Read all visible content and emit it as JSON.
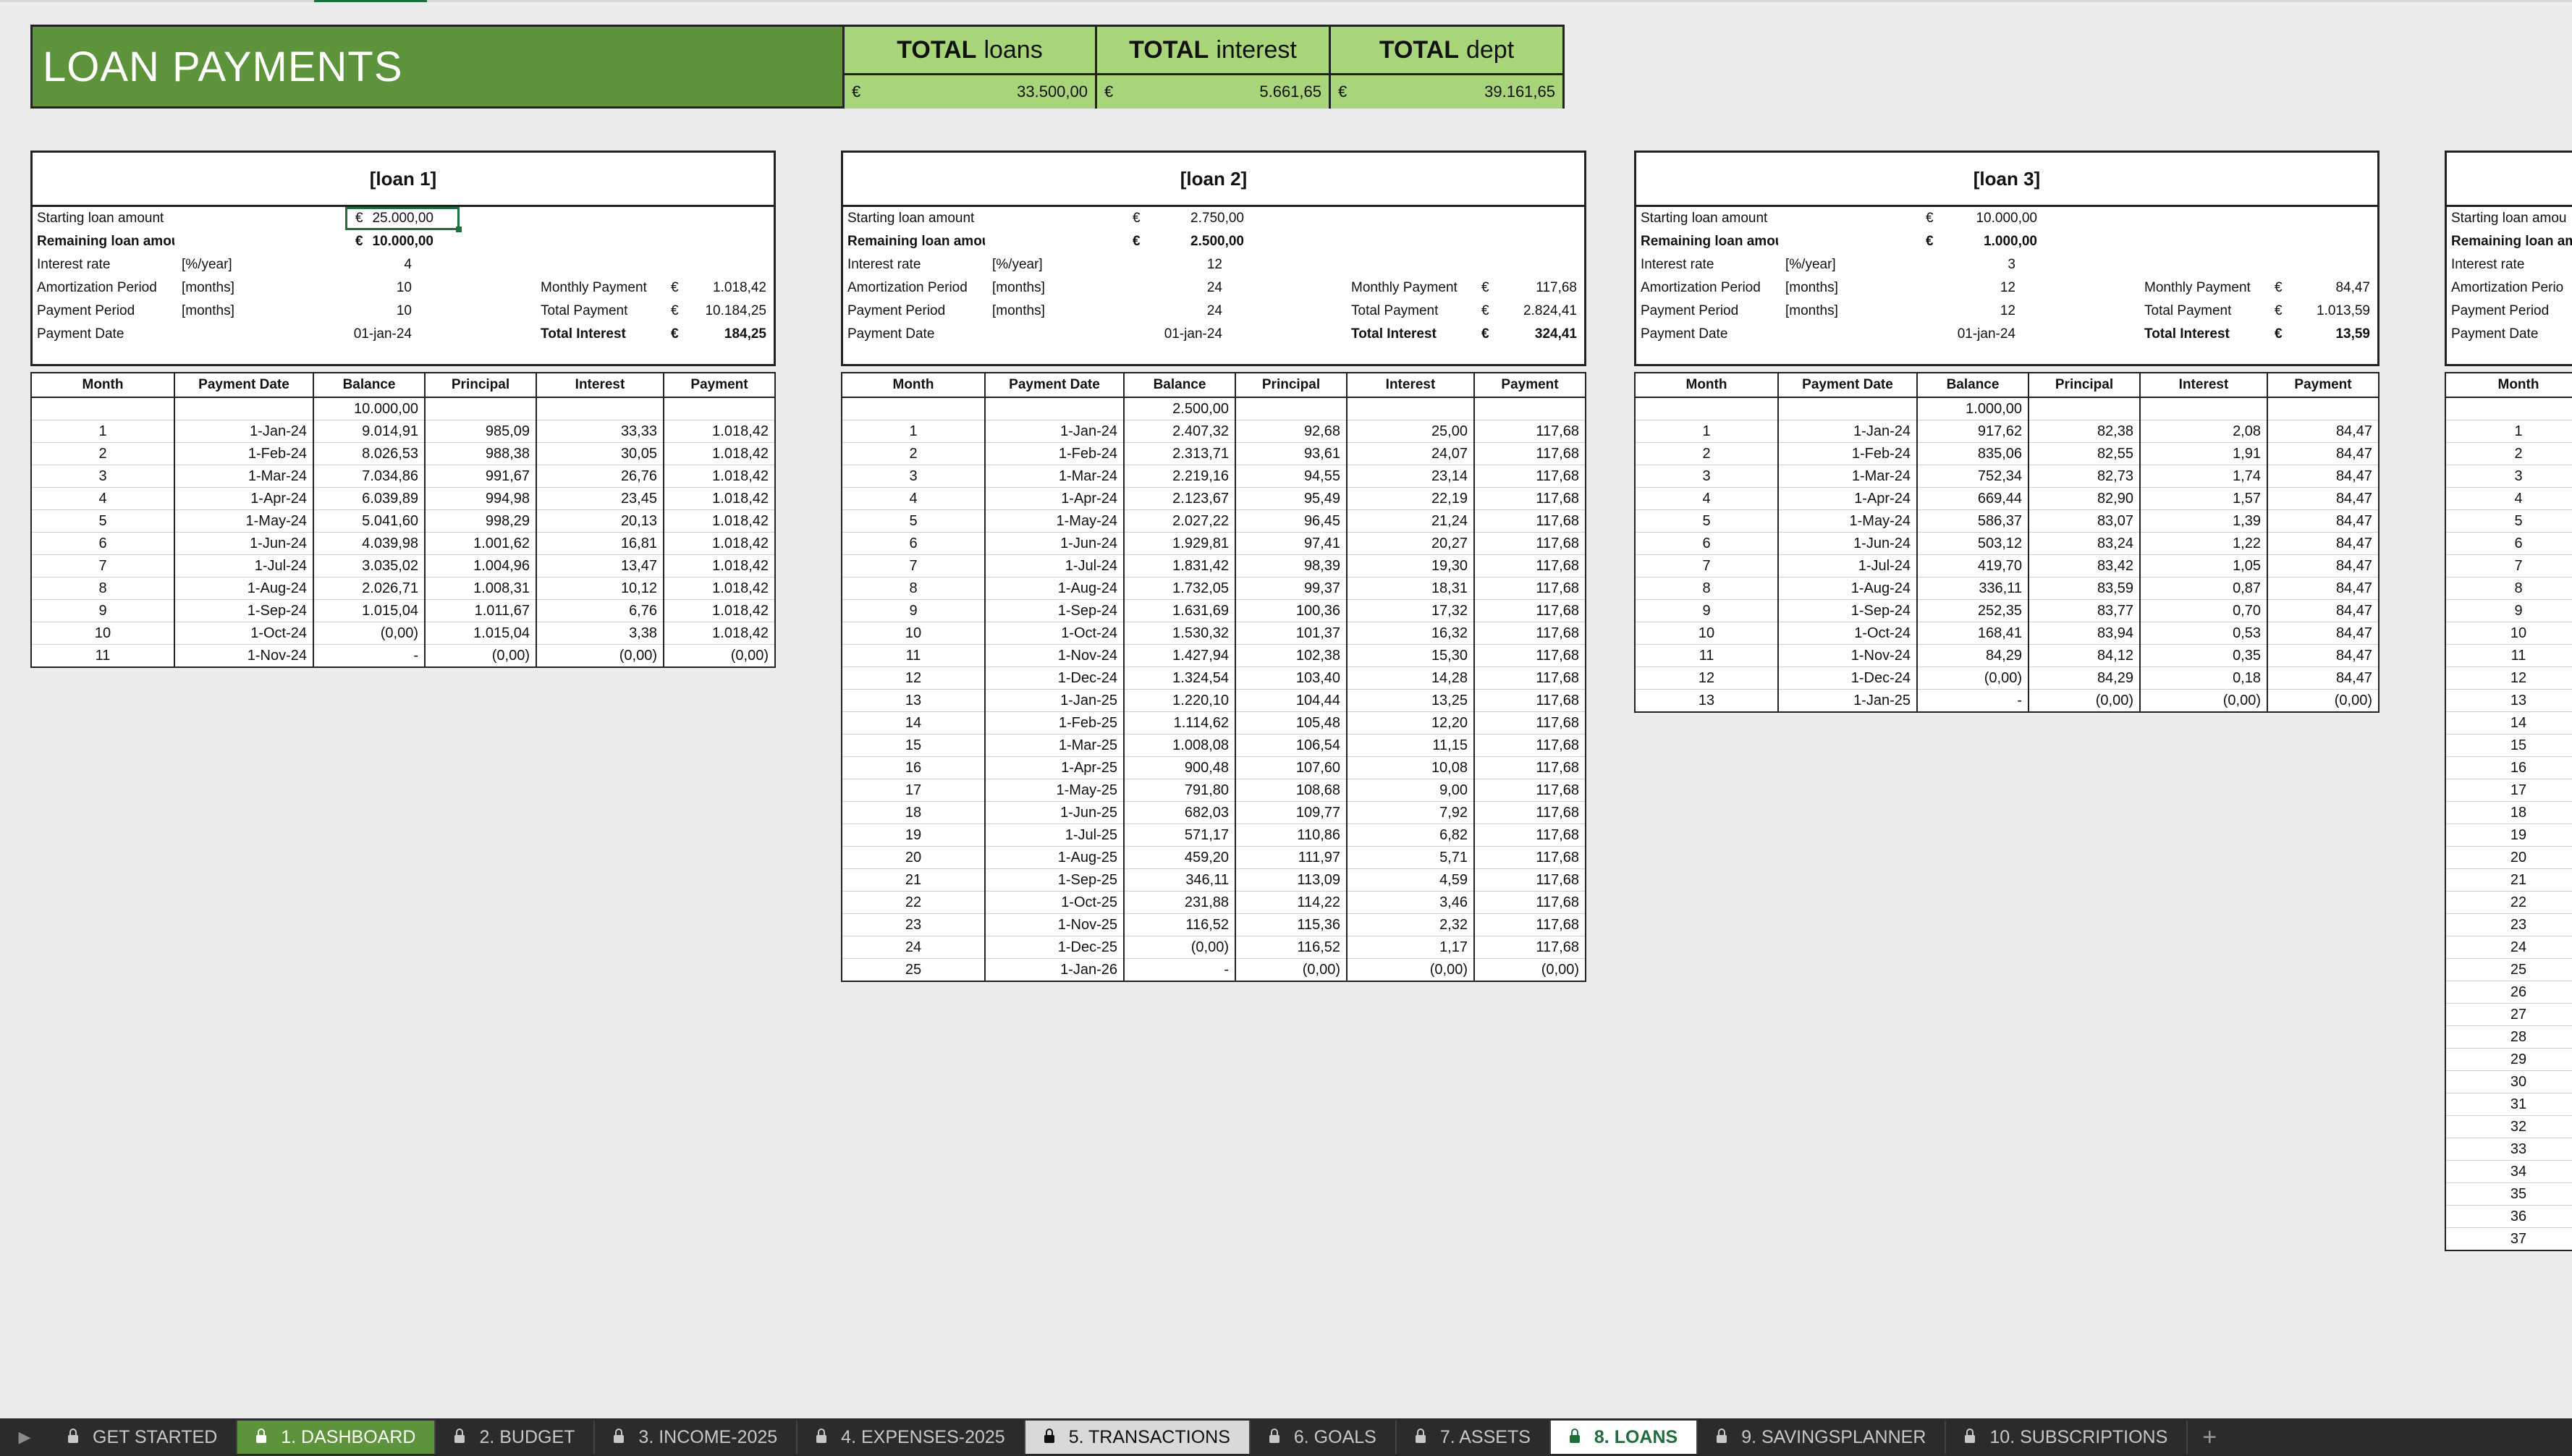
{
  "header": {
    "title": "LOAN PAYMENTS",
    "totals": [
      {
        "bold": "TOTAL",
        "rest": "loans",
        "currency": "€",
        "value": "33.500,00"
      },
      {
        "bold": "TOTAL",
        "rest": "interest",
        "currency": "€",
        "value": "5.661,65"
      },
      {
        "bold": "TOTAL",
        "rest": "dept",
        "currency": "€",
        "value": "39.161,65"
      }
    ]
  },
  "labels": {
    "starting": "Starting loan amount",
    "remaining": "Remaining loan amount",
    "interest_rate": "Interest rate",
    "amortization": "Amortization Period",
    "payment_period": "Payment Period",
    "payment_date": "Payment Date",
    "unit_rate": "[%/year]",
    "unit_months": "[months]",
    "monthly_payment": "Monthly Payment",
    "total_payment": "Total Payment",
    "total_interest": "Total Interest",
    "currency": "€"
  },
  "columns": [
    "Month",
    "Payment Date",
    "Balance",
    "Principal",
    "Interest",
    "Payment"
  ],
  "loans": [
    {
      "title": "[loan 1]",
      "starting": "25.000,00",
      "remaining": "10.000,00",
      "rate": "4",
      "amortization": "10",
      "period": "10",
      "date": "01-jan-24",
      "monthly_payment": "1.018,42",
      "total_payment": "10.184,25",
      "total_interest": "184,25",
      "initial_balance": "10.000,00",
      "rows": [
        [
          "1",
          "1-Jan-24",
          "9.014,91",
          "985,09",
          "33,33",
          "1.018,42"
        ],
        [
          "2",
          "1-Feb-24",
          "8.026,53",
          "988,38",
          "30,05",
          "1.018,42"
        ],
        [
          "3",
          "1-Mar-24",
          "7.034,86",
          "991,67",
          "26,76",
          "1.018,42"
        ],
        [
          "4",
          "1-Apr-24",
          "6.039,89",
          "994,98",
          "23,45",
          "1.018,42"
        ],
        [
          "5",
          "1-May-24",
          "5.041,60",
          "998,29",
          "20,13",
          "1.018,42"
        ],
        [
          "6",
          "1-Jun-24",
          "4.039,98",
          "1.001,62",
          "16,81",
          "1.018,42"
        ],
        [
          "7",
          "1-Jul-24",
          "3.035,02",
          "1.004,96",
          "13,47",
          "1.018,42"
        ],
        [
          "8",
          "1-Aug-24",
          "2.026,71",
          "1.008,31",
          "10,12",
          "1.018,42"
        ],
        [
          "9",
          "1-Sep-24",
          "1.015,04",
          "1.011,67",
          "6,76",
          "1.018,42"
        ],
        [
          "10",
          "1-Oct-24",
          "(0,00)",
          "1.015,04",
          "3,38",
          "1.018,42"
        ],
        [
          "11",
          "1-Nov-24",
          "-",
          "(0,00)",
          "(0,00)",
          "(0,00)"
        ]
      ]
    },
    {
      "title": "[loan 2]",
      "starting": "2.750,00",
      "remaining": "2.500,00",
      "rate": "12",
      "amortization": "24",
      "period": "24",
      "date": "01-jan-24",
      "monthly_payment": "117,68",
      "total_payment": "2.824,41",
      "total_interest": "324,41",
      "initial_balance": "2.500,00",
      "rows": [
        [
          "1",
          "1-Jan-24",
          "2.407,32",
          "92,68",
          "25,00",
          "117,68"
        ],
        [
          "2",
          "1-Feb-24",
          "2.313,71",
          "93,61",
          "24,07",
          "117,68"
        ],
        [
          "3",
          "1-Mar-24",
          "2.219,16",
          "94,55",
          "23,14",
          "117,68"
        ],
        [
          "4",
          "1-Apr-24",
          "2.123,67",
          "95,49",
          "22,19",
          "117,68"
        ],
        [
          "5",
          "1-May-24",
          "2.027,22",
          "96,45",
          "21,24",
          "117,68"
        ],
        [
          "6",
          "1-Jun-24",
          "1.929,81",
          "97,41",
          "20,27",
          "117,68"
        ],
        [
          "7",
          "1-Jul-24",
          "1.831,42",
          "98,39",
          "19,30",
          "117,68"
        ],
        [
          "8",
          "1-Aug-24",
          "1.732,05",
          "99,37",
          "18,31",
          "117,68"
        ],
        [
          "9",
          "1-Sep-24",
          "1.631,69",
          "100,36",
          "17,32",
          "117,68"
        ],
        [
          "10",
          "1-Oct-24",
          "1.530,32",
          "101,37",
          "16,32",
          "117,68"
        ],
        [
          "11",
          "1-Nov-24",
          "1.427,94",
          "102,38",
          "15,30",
          "117,68"
        ],
        [
          "12",
          "1-Dec-24",
          "1.324,54",
          "103,40",
          "14,28",
          "117,68"
        ],
        [
          "13",
          "1-Jan-25",
          "1.220,10",
          "104,44",
          "13,25",
          "117,68"
        ],
        [
          "14",
          "1-Feb-25",
          "1.114,62",
          "105,48",
          "12,20",
          "117,68"
        ],
        [
          "15",
          "1-Mar-25",
          "1.008,08",
          "106,54",
          "11,15",
          "117,68"
        ],
        [
          "16",
          "1-Apr-25",
          "900,48",
          "107,60",
          "10,08",
          "117,68"
        ],
        [
          "17",
          "1-May-25",
          "791,80",
          "108,68",
          "9,00",
          "117,68"
        ],
        [
          "18",
          "1-Jun-25",
          "682,03",
          "109,77",
          "7,92",
          "117,68"
        ],
        [
          "19",
          "1-Jul-25",
          "571,17",
          "110,86",
          "6,82",
          "117,68"
        ],
        [
          "20",
          "1-Aug-25",
          "459,20",
          "111,97",
          "5,71",
          "117,68"
        ],
        [
          "21",
          "1-Sep-25",
          "346,11",
          "113,09",
          "4,59",
          "117,68"
        ],
        [
          "22",
          "1-Oct-25",
          "231,88",
          "114,22",
          "3,46",
          "117,68"
        ],
        [
          "23",
          "1-Nov-25",
          "116,52",
          "115,36",
          "2,32",
          "117,68"
        ],
        [
          "24",
          "1-Dec-25",
          "(0,00)",
          "116,52",
          "1,17",
          "117,68"
        ],
        [
          "25",
          "1-Jan-26",
          "-",
          "(0,00)",
          "(0,00)",
          "(0,00)"
        ]
      ]
    },
    {
      "title": "[loan 3]",
      "starting": "10.000,00",
      "remaining": "1.000,00",
      "rate": "3",
      "amortization": "12",
      "period": "12",
      "date": "01-jan-24",
      "monthly_payment": "84,47",
      "total_payment": "1.013,59",
      "total_interest": "13,59",
      "initial_balance": "1.000,00",
      "rows": [
        [
          "1",
          "1-Jan-24",
          "917,62",
          "82,38",
          "2,08",
          "84,47"
        ],
        [
          "2",
          "1-Feb-24",
          "835,06",
          "82,55",
          "1,91",
          "84,47"
        ],
        [
          "3",
          "1-Mar-24",
          "752,34",
          "82,73",
          "1,74",
          "84,47"
        ],
        [
          "4",
          "1-Apr-24",
          "669,44",
          "82,90",
          "1,57",
          "84,47"
        ],
        [
          "5",
          "1-May-24",
          "586,37",
          "83,07",
          "1,39",
          "84,47"
        ],
        [
          "6",
          "1-Jun-24",
          "503,12",
          "83,24",
          "1,22",
          "84,47"
        ],
        [
          "7",
          "1-Jul-24",
          "419,70",
          "83,42",
          "1,05",
          "84,47"
        ],
        [
          "8",
          "1-Aug-24",
          "336,11",
          "83,59",
          "0,87",
          "84,47"
        ],
        [
          "9",
          "1-Sep-24",
          "252,35",
          "83,77",
          "0,70",
          "84,47"
        ],
        [
          "10",
          "1-Oct-24",
          "168,41",
          "83,94",
          "0,53",
          "84,47"
        ],
        [
          "11",
          "1-Nov-24",
          "84,29",
          "84,12",
          "0,35",
          "84,47"
        ],
        [
          "12",
          "1-Dec-24",
          "(0,00)",
          "84,29",
          "0,18",
          "84,47"
        ],
        [
          "13",
          "1-Jan-25",
          "-",
          "(0,00)",
          "(0,00)",
          "(0,00)"
        ]
      ]
    }
  ],
  "loan4_partial": {
    "labels": [
      "Starting loan amou",
      "Remaining loan am",
      "Interest rate",
      "Amortization Perio",
      "Payment Period",
      "Payment Date"
    ],
    "months": [
      "1",
      "2",
      "3",
      "4",
      "5",
      "6",
      "7",
      "8",
      "9",
      "10",
      "11",
      "12",
      "13",
      "14",
      "15",
      "16",
      "17",
      "18",
      "19",
      "20",
      "21",
      "22",
      "23",
      "24",
      "25",
      "26",
      "27",
      "28",
      "29",
      "30",
      "31",
      "32",
      "33",
      "34",
      "35",
      "36",
      "37"
    ]
  },
  "tabs": [
    {
      "label": "GET STARTED",
      "style": "normal"
    },
    {
      "label": "1. DASHBOARD",
      "style": "green"
    },
    {
      "label": "2. BUDGET",
      "style": "normal"
    },
    {
      "label": "3. INCOME-2025",
      "style": "normal"
    },
    {
      "label": "4. EXPENSES-2025",
      "style": "normal"
    },
    {
      "label": "5. TRANSACTIONS",
      "style": "gray"
    },
    {
      "label": "6. GOALS",
      "style": "normal"
    },
    {
      "label": "7. ASSETS",
      "style": "normal"
    },
    {
      "label": "8. LOANS",
      "style": "active"
    },
    {
      "label": "9. SAVINGSPLANNER",
      "style": "normal"
    },
    {
      "label": "10. SUBSCRIPTIONS",
      "style": "normal"
    }
  ],
  "tab_add": "+"
}
